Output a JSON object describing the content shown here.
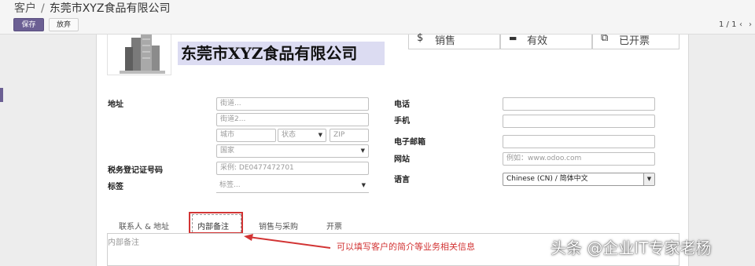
{
  "breadcrumb": {
    "parent": "客户",
    "separator": "/",
    "current": "东莞市XYZ食品有限公司"
  },
  "toolbar": {
    "save_label": "保存",
    "discard_label": "放弃"
  },
  "pager": {
    "text": "1 / 1",
    "prev": "‹",
    "next": "›"
  },
  "company": {
    "name": "东莞市XYZ食品有限公司"
  },
  "stat_buttons": [
    {
      "icon": "$",
      "label": "销售"
    },
    {
      "icon": "▬",
      "label": "有效"
    },
    {
      "icon": "⧉",
      "label": "已开票"
    }
  ],
  "labels": {
    "address": "地址",
    "tax_id": "税务登记证号码",
    "tags": "标签",
    "phone": "电话",
    "mobile": "手机",
    "email": "电子邮箱",
    "website": "网站",
    "language": "语言"
  },
  "placeholders": {
    "street": "街道...",
    "street2": "街道2...",
    "city": "城市",
    "state": "状态",
    "zip": "ZIP",
    "country": "国家",
    "tax_id": "采例: DE0477472701",
    "tags": "标签...",
    "website": "例如：www.odoo.com"
  },
  "language_value": "Chinese (CN) / 简体中文",
  "tabs": [
    "联系人 & 地址",
    "内部备注",
    "销售与采购",
    "开票"
  ],
  "tab_content": {
    "placeholder": "内部备注"
  },
  "annotation": {
    "text": "可以填写客户的简介等业务相关信息"
  },
  "watermark": {
    "text": "头条 @企业IT专家老杨"
  }
}
